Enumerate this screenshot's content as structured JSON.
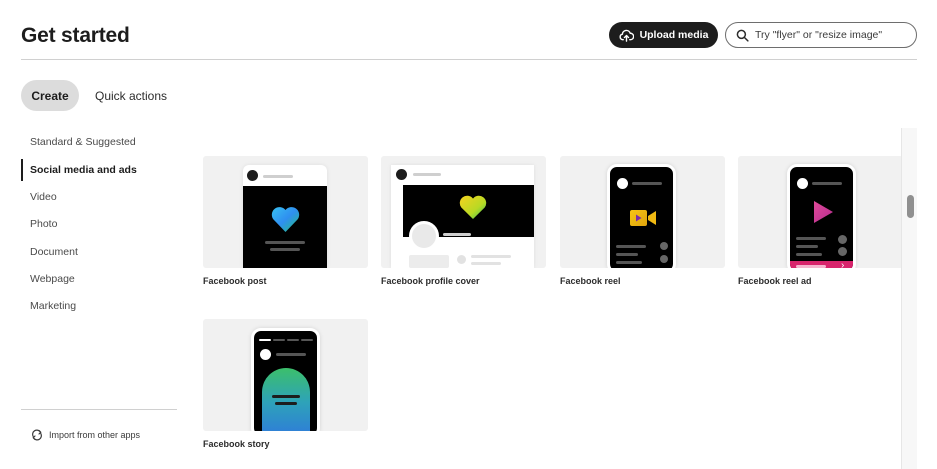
{
  "header": {
    "title": "Get started",
    "upload_label": "Upload media",
    "search_placeholder": "Try \"flyer\" or \"resize image\""
  },
  "tabs": [
    {
      "label": "Create",
      "selected": true
    },
    {
      "label": "Quick actions",
      "selected": false
    }
  ],
  "sidebar": {
    "items": [
      {
        "label": "Standard & Suggested",
        "active": false
      },
      {
        "label": "Social media and ads",
        "active": true
      },
      {
        "label": "Video",
        "active": false
      },
      {
        "label": "Photo",
        "active": false
      },
      {
        "label": "Document",
        "active": false
      },
      {
        "label": "Webpage",
        "active": false
      },
      {
        "label": "Marketing",
        "active": false
      }
    ],
    "import_label": "Import from other apps"
  },
  "templates": [
    {
      "label": "Facebook post",
      "icon": "heart-gradient"
    },
    {
      "label": "Facebook profile cover",
      "icon": "heart-yellow-green"
    },
    {
      "label": "Facebook reel",
      "icon": "video-camera"
    },
    {
      "label": "Facebook reel ad",
      "icon": "play-triangle"
    },
    {
      "label": "Facebook story",
      "icon": "gradient-arch"
    }
  ],
  "colors": {
    "dark": "#1d1d1d",
    "tab_selected_bg": "#dcdcdc",
    "thumb_bg": "#f1f1f1",
    "reel_ad_accent": "#d8246c"
  }
}
